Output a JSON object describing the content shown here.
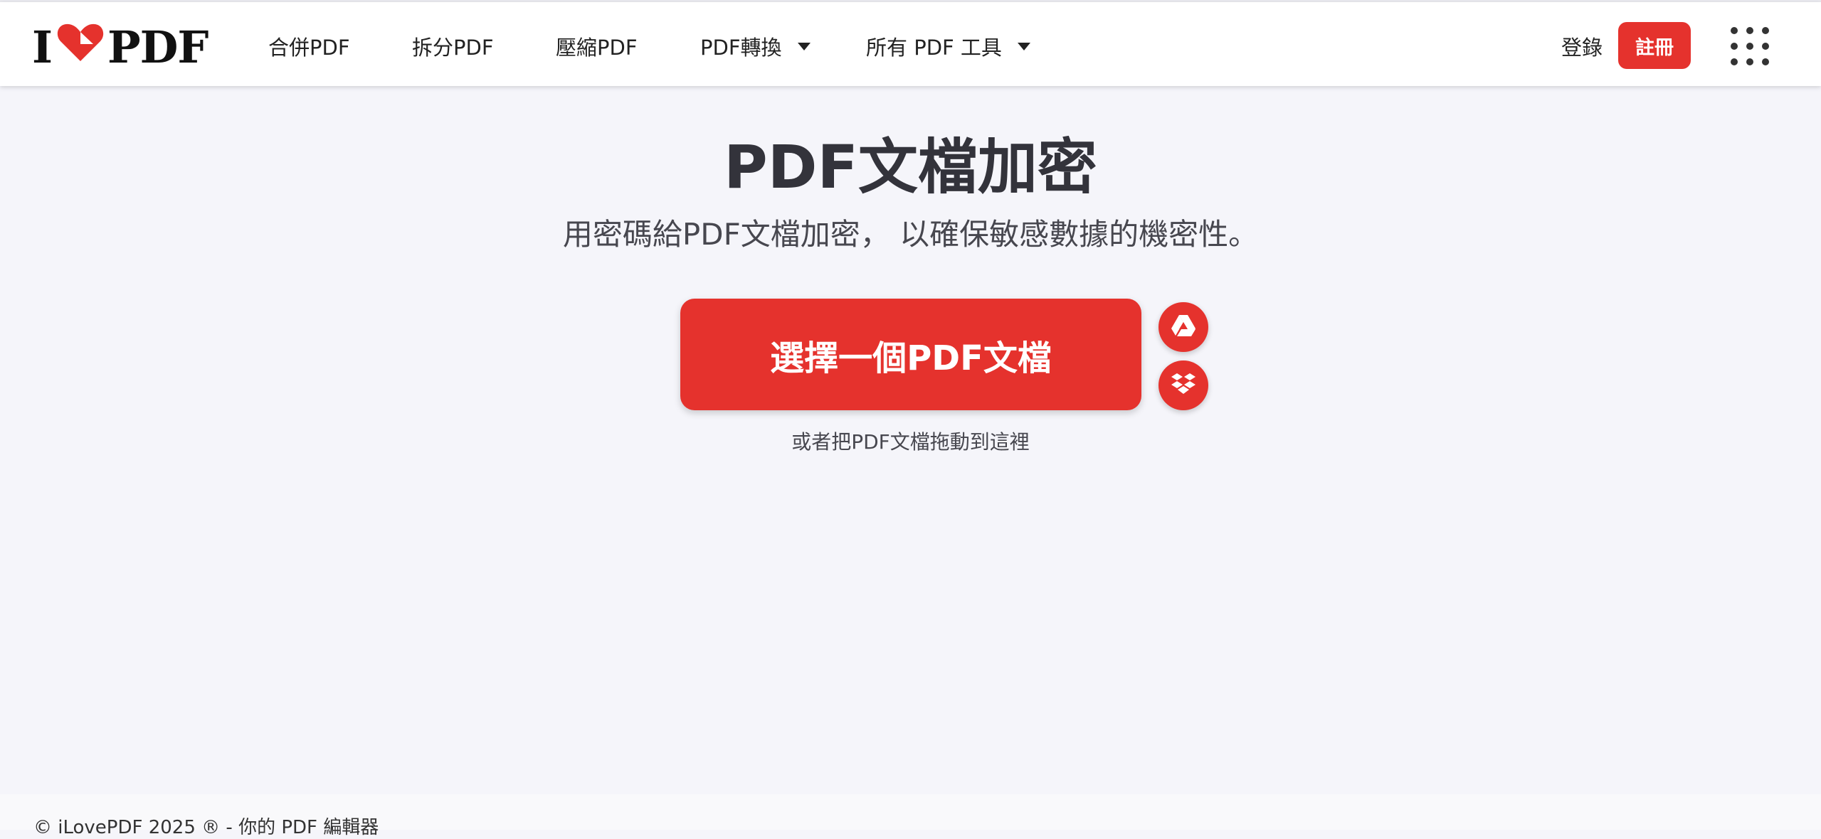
{
  "header": {
    "logo": {
      "left": "I",
      "right": "PDF",
      "brand_color": "#e5322d"
    },
    "nav": [
      {
        "label": "合併PDF"
      },
      {
        "label": "拆分PDF"
      },
      {
        "label": "壓縮PDF"
      },
      {
        "label": "PDF轉換"
      },
      {
        "label": "所有 PDF 工具"
      }
    ],
    "login_label": "登錄",
    "signup_label": "註冊",
    "apps_icon": "grid-dots-icon"
  },
  "main": {
    "title": "PDF文檔加密",
    "subtitle": "用密碼給PDF文檔加密， 以確保敏感數據的機密性。",
    "select_button_label": "選擇一個PDF文檔",
    "cloud_buttons": [
      {
        "icon": "google-drive-icon"
      },
      {
        "icon": "dropbox-icon"
      }
    ],
    "drop_hint": "或者把PDF文檔拖動到這裡"
  },
  "footer": {
    "copyright": "© iLovePDF 2025 ® - 你的 PDF 編輯器"
  },
  "colors": {
    "accent": "#e5322d",
    "background": "#f5f5fa",
    "text": "#33333b"
  }
}
